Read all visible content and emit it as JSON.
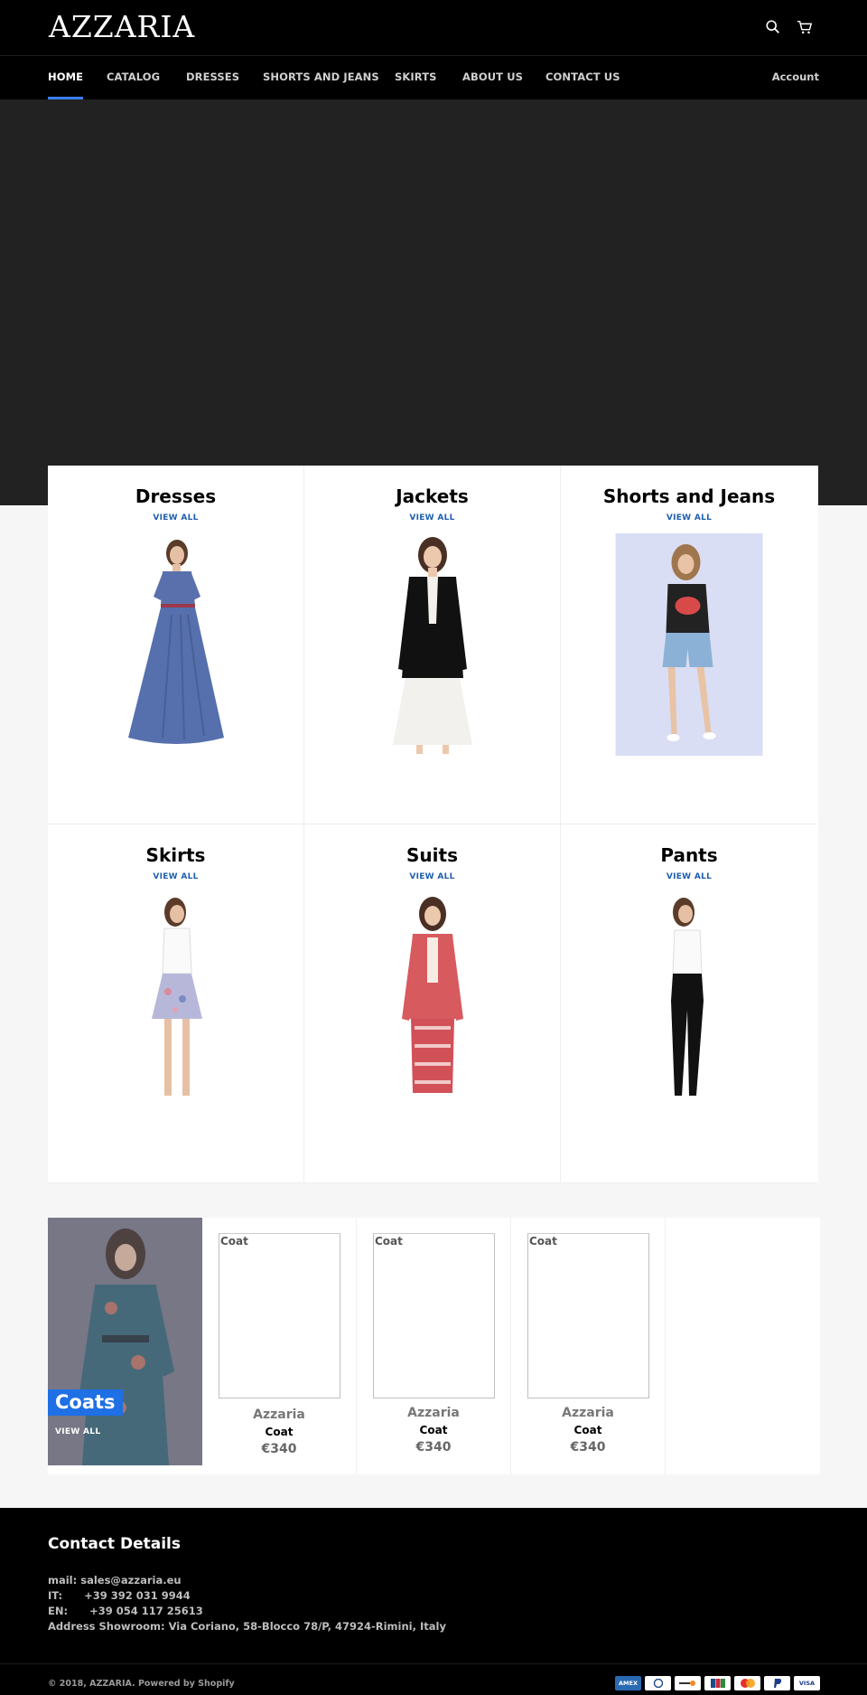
{
  "header": {
    "logo": "AZZARIA",
    "icons": [
      "search-icon",
      "cart-icon"
    ]
  },
  "nav": {
    "items": [
      {
        "label": "HOME",
        "active": true
      },
      {
        "label": "CATALOG"
      },
      {
        "label": "DRESSES"
      },
      {
        "label": "SHORTS AND JEANS"
      },
      {
        "label": "SKIRTS"
      },
      {
        "label": "ABOUT US"
      },
      {
        "label": "CONTACT US"
      }
    ],
    "account": "Account",
    "active_color": "#3b7ff2"
  },
  "collections": [
    {
      "title": "Dresses",
      "link": "VIEW ALL",
      "image": "blue-long-dress"
    },
    {
      "title": "Jackets",
      "link": "VIEW ALL",
      "image": "black-blazer"
    },
    {
      "title": "Shorts and Jeans",
      "link": "VIEW ALL",
      "image": "denim-shorts"
    },
    {
      "title": "Skirts",
      "link": "VIEW ALL",
      "image": "floral-skirt"
    },
    {
      "title": "Suits",
      "link": "VIEW ALL",
      "image": "red-pattern-suit"
    },
    {
      "title": "Pants",
      "link": "VIEW ALL",
      "image": "black-pants"
    }
  ],
  "featured": {
    "title": "Coats",
    "link": "VIEW ALL",
    "title_bg": "#1f6fe5",
    "products": [
      {
        "alt": "Coat",
        "vendor": "Azzaria",
        "name": "Coat",
        "price": "€340"
      },
      {
        "alt": "Coat",
        "vendor": "Azzaria",
        "name": "Coat",
        "price": "€340"
      },
      {
        "alt": "Coat",
        "vendor": "Azzaria",
        "name": "Coat",
        "price": "€340"
      }
    ]
  },
  "footer": {
    "title": "Contact Details",
    "mail": "mail: sales@azzaria.eu",
    "it": "IT:      +39 392 031 9944",
    "en": "EN:      +39 054 117 25613",
    "address": "Address Showroom: Via Coriano, 58-Blocco 78/P, 47924-Rimini, Italy",
    "copyright": "© 2018, AZZARIA. Powered by Shopify",
    "payment_icons": [
      "AMEX",
      "Diners",
      "Discover",
      "JCB",
      "Master",
      "PayPal",
      "VISA"
    ]
  }
}
